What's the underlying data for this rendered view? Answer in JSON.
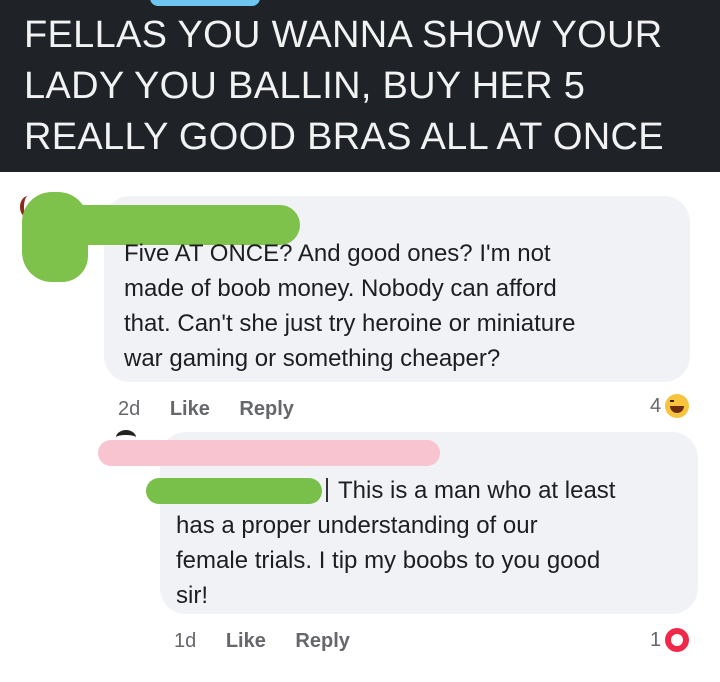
{
  "header": {
    "lines": [
      "FELLAS YOU WANNA SHOW YOUR",
      "LADY YOU BALLIN, BUY HER 5",
      "REALLY GOOD BRAS ALL AT ONCE"
    ]
  },
  "comments": [
    {
      "lines": [
        "Five AT ONCE?  And good ones?  I'm not",
        "made of boob money.  Nobody can afford",
        "that.  Can't she just try heroine or miniature",
        "war gaming or something cheaper?"
      ],
      "time": "2d",
      "like_label": "Like",
      "reply_label": "Reply",
      "reaction_count": "4",
      "reaction_icon": "haha-emoji-icon"
    },
    {
      "lines": [
        "This is a man who at least",
        "has a proper understanding of our",
        "female trials. I tip my boobs to you good",
        "sir!"
      ],
      "time": "1d",
      "like_label": "Like",
      "reply_label": "Reply",
      "reaction_count": "1",
      "reaction_icon": "love-reaction-icon"
    }
  ],
  "colors": {
    "header_bg": "#1f2328",
    "bubble_bg": "#f0f2f5",
    "redaction_green": "#7fc24b",
    "redaction_pink": "#f7c4d0"
  }
}
